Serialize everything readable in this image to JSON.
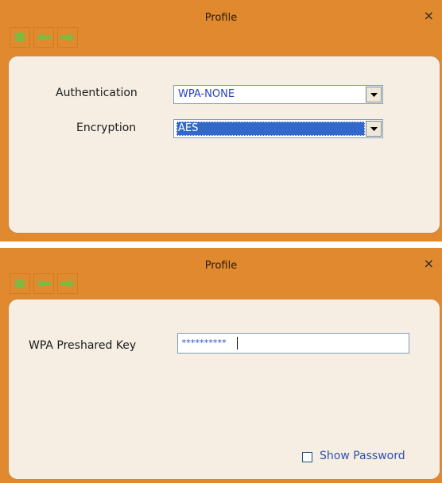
{
  "top_dialog": {
    "title": "Profile",
    "close_glyph": "×",
    "nav": [
      "stop-icon",
      "back-arrow-icon",
      "forward-arrow-icon"
    ],
    "authentication": {
      "label": "Authentication",
      "value": "WPA-NONE"
    },
    "encryption": {
      "label": "Encryption",
      "value": "AES"
    }
  },
  "bottom_dialog": {
    "title": "Profile",
    "close_glyph": "×",
    "nav": [
      "stop-icon",
      "back-arrow-icon",
      "forward-arrow-icon"
    ],
    "wpa_key": {
      "label": "WPA Preshared Key",
      "value": "**********"
    },
    "show_password": {
      "label": "Show Password",
      "checked": false
    }
  },
  "colors": {
    "titlebar": "#e0892e",
    "panel": "#f6eee2",
    "nav_icon": "#74c043",
    "selection": "#3168c9",
    "value_text": "#2840c0"
  }
}
